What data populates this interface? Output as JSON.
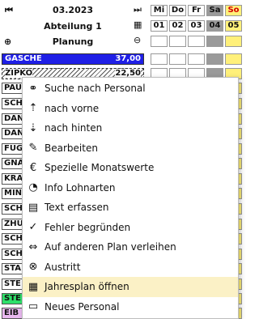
{
  "header": {
    "month": "03.2023",
    "department": "Abteilung 1",
    "plan": "Planung"
  },
  "days": {
    "weekdays": [
      "Mi",
      "Do",
      "Fr",
      "Sa",
      "So"
    ],
    "dates": [
      "01",
      "02",
      "03",
      "04",
      "05"
    ]
  },
  "rows": {
    "gasche": {
      "name": "GASCHE",
      "hours": "37,00",
      "color": "#1f1fe6"
    },
    "zipko": {
      "name": "ZIPKO",
      "hours": "22,50"
    }
  },
  "employees": [
    "PAU",
    "SCH",
    "DAN",
    "DAN",
    "FUG",
    "GNA",
    "KRA",
    "MIN",
    "SCH",
    "ZHU",
    "SCH",
    "SCH",
    "STA",
    "STE",
    "STE",
    "EIB"
  ],
  "menu": {
    "items": [
      {
        "label": "Suche nach Personal",
        "icon": "binoculars-icon"
      },
      {
        "label": "nach vorne",
        "icon": "sort-up-icon"
      },
      {
        "label": "nach hinten",
        "icon": "sort-down-icon"
      },
      {
        "label": "Bearbeiten",
        "icon": "edit-icon"
      },
      {
        "label": "Spezielle Monatswerte",
        "icon": "euro-icon"
      },
      {
        "label": "Info Lohnarten",
        "icon": "piggy-bank-icon"
      },
      {
        "label": "Text erfassen",
        "icon": "document-icon"
      },
      {
        "label": "Fehler begründen",
        "icon": "check-icon"
      },
      {
        "label": "Auf anderen Plan verleihen",
        "icon": "transfer-icon"
      },
      {
        "label": "Austritt",
        "icon": "close-circle-icon"
      },
      {
        "label": "Jahresplan öffnen",
        "icon": "calendar-icon"
      },
      {
        "label": "Neues Personal",
        "icon": "id-card-icon"
      }
    ],
    "highlighted_index": 10
  }
}
